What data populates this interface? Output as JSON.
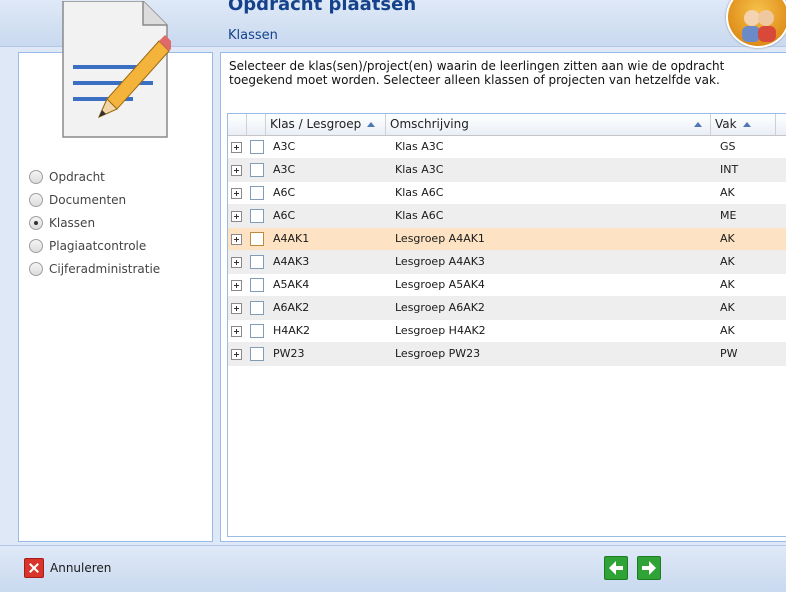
{
  "dialog": {
    "title": "Opdracht plaatsen",
    "subtitle": "Klassen"
  },
  "instruction": "Selecteer de klas(sen)/project(en) waarin de leerlingen zitten aan wie de opdracht toegekend moet worden. Selecteer alleen klassen of projecten van hetzelfde vak.",
  "steps": [
    {
      "label": "Opdracht",
      "checked": false
    },
    {
      "label": "Documenten",
      "checked": false
    },
    {
      "label": "Klassen",
      "checked": true
    },
    {
      "label": "Plagiaatcontrole",
      "checked": false
    },
    {
      "label": "Cijferadministratie",
      "checked": false
    }
  ],
  "grid": {
    "columns": {
      "klas": "Klas / Lesgroep",
      "oms": "Omschrijving",
      "vak": "Vak"
    },
    "rows": [
      {
        "klas": "A3C",
        "oms": "Klas A3C",
        "vak": "GS"
      },
      {
        "klas": "A3C",
        "oms": "Klas A3C",
        "vak": "INT"
      },
      {
        "klas": "A6C",
        "oms": "Klas A6C",
        "vak": "AK"
      },
      {
        "klas": "A6C",
        "oms": "Klas A6C",
        "vak": "ME"
      },
      {
        "klas": "A4AK1",
        "oms": "Lesgroep A4AK1",
        "vak": "AK"
      },
      {
        "klas": "A4AK3",
        "oms": "Lesgroep A4AK3",
        "vak": "AK"
      },
      {
        "klas": "A5AK4",
        "oms": "Lesgroep A5AK4",
        "vak": "AK"
      },
      {
        "klas": "A6AK2",
        "oms": "Lesgroep A6AK2",
        "vak": "AK"
      },
      {
        "klas": "H4AK2",
        "oms": "Lesgroep H4AK2",
        "vak": "AK"
      },
      {
        "klas": "PW23",
        "oms": "Lesgroep PW23",
        "vak": "PW"
      }
    ],
    "selected_row": 4
  },
  "footer": {
    "cancel_label": "Annuleren",
    "icons": {
      "cancel": "cancel-x-icon",
      "prev": "arrow-left-icon",
      "next": "arrow-right-icon"
    }
  },
  "colors": {
    "accent": "#15428b",
    "selected_row": "#fde3c3",
    "nav_green": "#2fa336"
  }
}
